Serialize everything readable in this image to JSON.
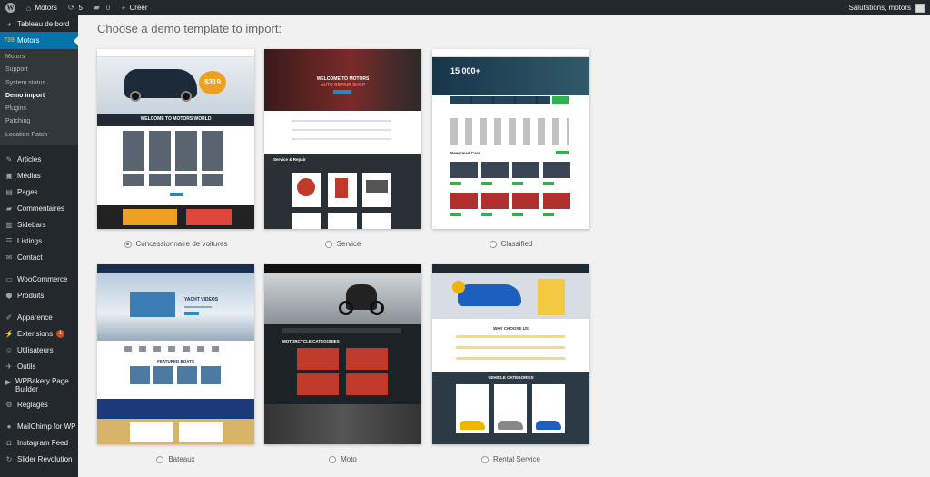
{
  "adminbar": {
    "site_name": "Motors",
    "updates_count": "5",
    "comments_count": "0",
    "new_label": "Créer",
    "greeting": "Salutations, motors"
  },
  "sidebar": {
    "dashboard": "Tableau de bord",
    "motors": "Motors",
    "motors_icon": "739",
    "submenu": [
      "Motors",
      "Support",
      "System status",
      "Demo import",
      "Plugins",
      "Patching",
      "Location Patch"
    ],
    "items": [
      {
        "label": "Articles",
        "icon": "pin-icon"
      },
      {
        "label": "Médias",
        "icon": "media-icon"
      },
      {
        "label": "Pages",
        "icon": "pages-icon"
      },
      {
        "label": "Commentaires",
        "icon": "comment-icon"
      },
      {
        "label": "Sidebars",
        "icon": "sidebars-icon"
      },
      {
        "label": "Listings",
        "icon": "listings-icon"
      },
      {
        "label": "Contact",
        "icon": "contact-icon"
      },
      {
        "label": "WooCommerce",
        "icon": "woo-icon"
      },
      {
        "label": "Produits",
        "icon": "products-icon"
      },
      {
        "label": "Apparence",
        "icon": "brush-icon"
      },
      {
        "label": "Extensions",
        "icon": "plugin-icon",
        "badge": "1"
      },
      {
        "label": "Utilisateurs",
        "icon": "users-icon"
      },
      {
        "label": "Outils",
        "icon": "tools-icon"
      },
      {
        "label": "WPBakery Page Builder",
        "icon": "wpbakery-icon"
      },
      {
        "label": "Réglages",
        "icon": "settings-icon"
      },
      {
        "label": "MailChimp for WP",
        "icon": "mailchimp-icon"
      },
      {
        "label": "Instagram Feed",
        "icon": "instagram-icon"
      },
      {
        "label": "Slider Revolution",
        "icon": "slider-icon"
      }
    ]
  },
  "main": {
    "heading": "Choose a demo template to import:",
    "templates": [
      {
        "label": "Concessionnaire de voitures",
        "selected": true,
        "thumb_title": "WELCOME TO MOTORS WORLD",
        "thumb_price": "$319"
      },
      {
        "label": "Service",
        "selected": false,
        "thumb_title": "WELCOME TO MOTORS",
        "thumb_sub": "AUTO REPAIR SHOP",
        "thumb_section": "Service & Repair"
      },
      {
        "label": "Classified",
        "selected": false,
        "thumb_title": "15 000+",
        "thumb_sub": "New/Used Cars"
      },
      {
        "label": "Bateaux",
        "selected": false,
        "thumb_title": "YACHT VIDEOS",
        "thumb_section": "FEATURED BOATS"
      },
      {
        "label": "Moto",
        "selected": false,
        "thumb_section": "MOTORCYCLE CATEGORIES"
      },
      {
        "label": "Rental Service",
        "selected": false,
        "thumb_title": "WHY CHOOSE US",
        "thumb_section": "VEHICLE CATEGORIES"
      }
    ]
  },
  "colors": {
    "adminbar_bg": "#23282d",
    "sidebar_bg": "#23282d",
    "current_menu": "#0073aa",
    "badge": "#ca4a1f",
    "accent_orange": "#f0a020"
  }
}
